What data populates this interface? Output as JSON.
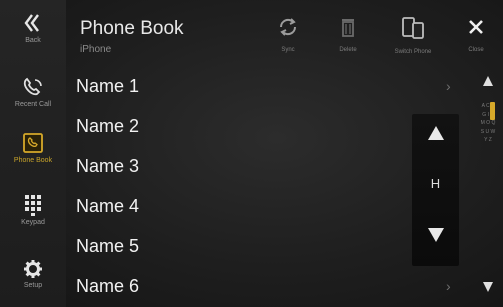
{
  "header": {
    "title": "Phone Book",
    "subtitle": "iPhone",
    "back_label": "Back",
    "close_label": "Close",
    "toolbar": [
      {
        "label": "Sync",
        "icon": "sync-icon"
      },
      {
        "label": "Delete",
        "icon": "trash-icon"
      },
      {
        "label": "Switch Phone",
        "icon": "switch-phone-icon"
      }
    ]
  },
  "sidebar": {
    "items": [
      {
        "label": "Recent Call",
        "icon": "recent-call-icon",
        "active": false
      },
      {
        "label": "Phone Book",
        "icon": "phone-book-icon",
        "active": true
      },
      {
        "label": "Keypad",
        "icon": "keypad-icon",
        "active": false
      },
      {
        "label": "Setup",
        "icon": "gear-icon",
        "active": false
      }
    ]
  },
  "contacts": [
    {
      "name": "Name 1"
    },
    {
      "name": "Name 2"
    },
    {
      "name": "Name 3"
    },
    {
      "name": "Name 4"
    },
    {
      "name": "Name 5"
    },
    {
      "name": "Name 6"
    }
  ],
  "jump": {
    "letter": "H"
  },
  "scrollbar": {
    "index": "A C E G I K M O Q S U W Y Z"
  },
  "colors": {
    "accent": "#d6a92a",
    "background": "#1e1e1e",
    "text": "#f2f2f2"
  }
}
